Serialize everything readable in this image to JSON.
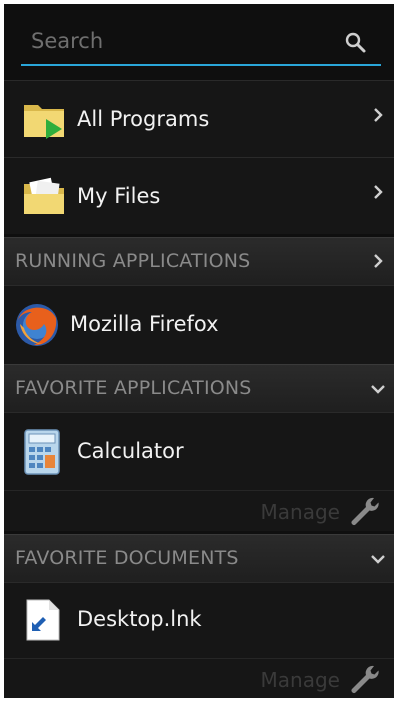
{
  "search": {
    "placeholder": "Search"
  },
  "nav_items": [
    {
      "label": "All Programs",
      "icon": "folder-play-icon"
    },
    {
      "label": "My Files",
      "icon": "folder-documents-icon"
    }
  ],
  "sections": {
    "running": {
      "label": "RUNNING APPLICATIONS",
      "icon": "chevron-right-icon"
    },
    "favorites": {
      "label": "FAVORITE APPLICATIONS",
      "icon": "chevron-down-icon"
    },
    "documents": {
      "label": "FAVORITE DOCUMENTS",
      "icon": "chevron-down-icon"
    }
  },
  "running_apps": [
    {
      "label": "Mozilla Firefox",
      "icon": "firefox-icon"
    }
  ],
  "favorite_apps": [
    {
      "label": "Calculator",
      "icon": "calculator-icon"
    }
  ],
  "favorite_docs": [
    {
      "label": "Desktop.lnk",
      "icon": "shortcut-file-icon"
    }
  ],
  "manage_label": "Manage",
  "colors": {
    "accent": "#2aa6d9",
    "background": "#0f0f0f",
    "text": "#f2f2f2"
  }
}
